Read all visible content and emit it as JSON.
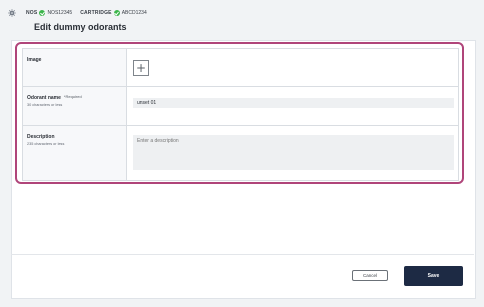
{
  "breadcrumb": {
    "items": [
      {
        "key": "NOS",
        "value": "NOS12345"
      },
      {
        "key": "CARTRIDGE",
        "value": "ABCD1234"
      }
    ]
  },
  "page": {
    "title": "Edit dummy odorants"
  },
  "form": {
    "image": {
      "label": "Image",
      "add_symbol": "+"
    },
    "odorant_name": {
      "label": "Odorant name",
      "required": "*Required",
      "hint": "30 characters or less",
      "value": "unset 01"
    },
    "description": {
      "label": "Description",
      "hint": "235 characters or less",
      "placeholder": "Enter a description",
      "value": ""
    }
  },
  "footer": {
    "cancel_label": "Cancel",
    "save_label": "Save"
  },
  "colors": {
    "status_ok": "#3bb54a",
    "highlight": "#b0457a",
    "primary": "#1d2a44"
  }
}
